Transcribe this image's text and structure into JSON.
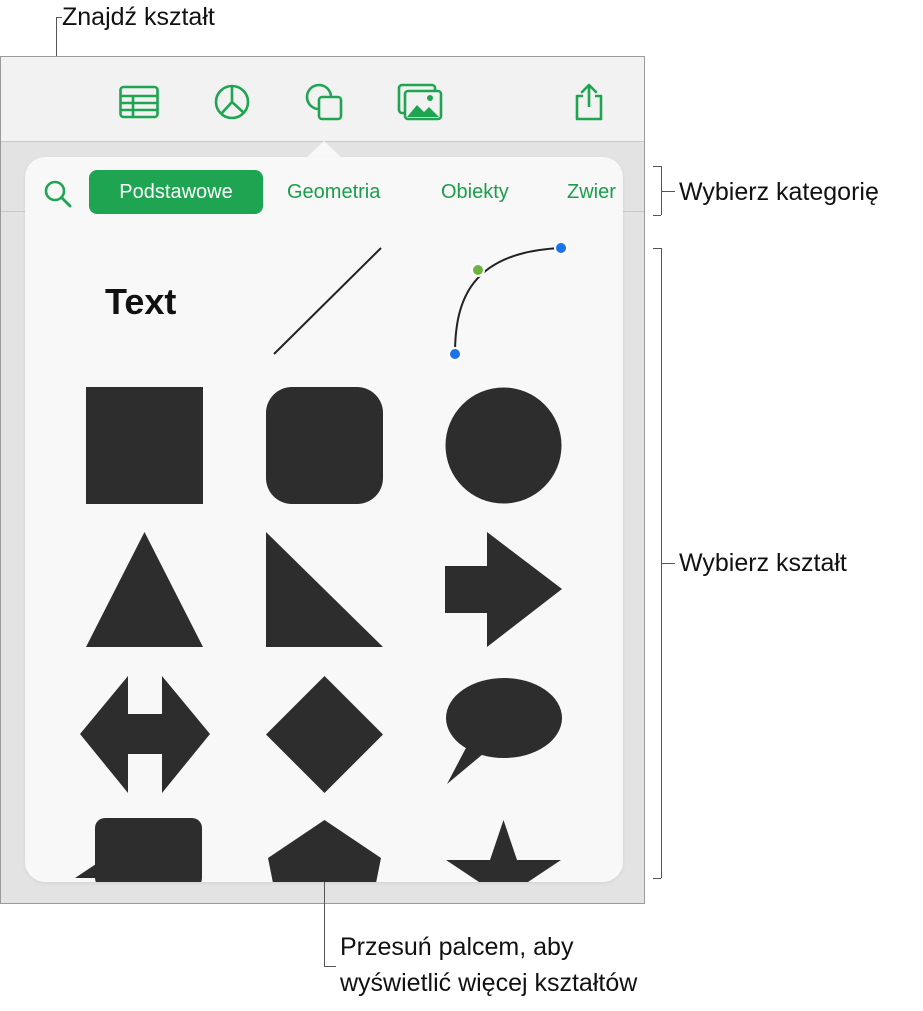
{
  "callouts": {
    "find_shape": "Znajdź kształt",
    "choose_category": "Wybierz kategorię",
    "choose_shape": "Wybierz kształt",
    "swipe_line1": "Przesuń palcem, aby",
    "swipe_line2": "wyświetlić więcej kształtów"
  },
  "toolbar": {
    "buttons": [
      {
        "icon": "table-icon"
      },
      {
        "icon": "chart-icon"
      },
      {
        "icon": "shape-icon"
      },
      {
        "icon": "media-icon"
      },
      {
        "icon": "share-icon"
      }
    ]
  },
  "shapes_popover": {
    "categories": [
      "Podstawowe",
      "Geometria",
      "Obiekty",
      "Zwier"
    ],
    "selected_category": "Podstawowe",
    "text_shape_label": "Text",
    "shapes": [
      "text",
      "line",
      "curve",
      "square",
      "rounded-square",
      "circle",
      "triangle",
      "right-triangle",
      "arrow",
      "double-arrow",
      "diamond",
      "speech-bubble",
      "callout-rectangle",
      "pentagon",
      "star"
    ]
  },
  "colors": {
    "accent": "#1FA552",
    "shape_fill": "#2D2D2D",
    "toolbar_bg": "#F2F2F2",
    "popover_bg": "#F8F8F8",
    "curve_point_blue": "#1A73E8",
    "curve_point_green": "#6DB33F"
  }
}
